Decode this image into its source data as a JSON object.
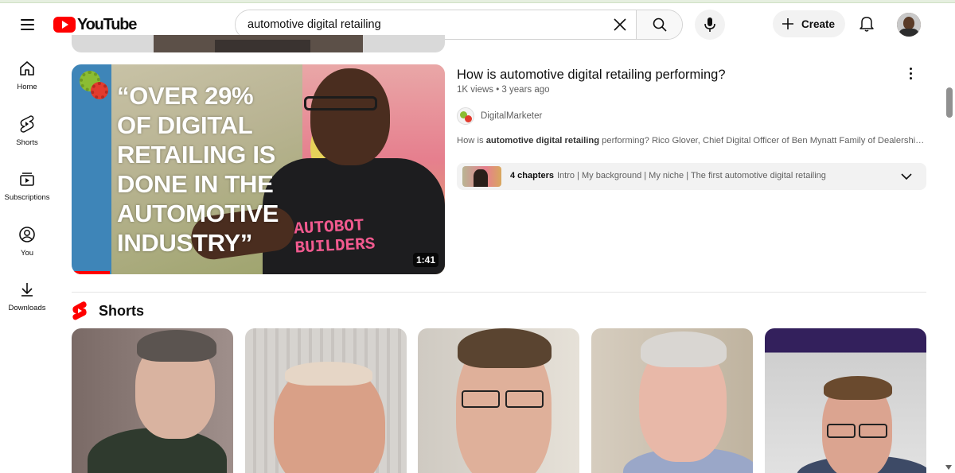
{
  "header": {
    "logo_text": "YouTube",
    "search_value": "automotive digital retailing",
    "create_label": "Create"
  },
  "sidebar": {
    "items": [
      {
        "label": "Home",
        "icon": "home-icon"
      },
      {
        "label": "Shorts",
        "icon": "shorts-icon"
      },
      {
        "label": "Subscriptions",
        "icon": "subscriptions-icon"
      },
      {
        "label": "You",
        "icon": "you-icon"
      },
      {
        "label": "Downloads",
        "icon": "download-icon"
      }
    ]
  },
  "video": {
    "thumbnail_text": "“OVER 29%\nOF DIGITAL\nRETAILING IS\nDONE IN THE\nAUTOMOTIVE\nINDUSTRY”",
    "thumbnail_shirt_text": "AUTOBOT\nBUILDERS",
    "duration": "1:41",
    "title": "How is automotive digital retailing performing?",
    "meta": "1K views • 3 years ago",
    "channel": "DigitalMarketer",
    "description_pre": "How is ",
    "description_bold": "automotive digital retailing",
    "description_post": " performing? Rico Glover, Chief Digital Officer of Ben Mynatt Family of Dealerships,...",
    "chapters_count": "4 chapters",
    "chapters_list": "Intro | My background | My niche | The first automotive digital retailing"
  },
  "shorts": {
    "title": "Shorts"
  },
  "colors": {
    "brand_red": "#ff0000",
    "text_primary": "#0f0f0f",
    "text_secondary": "#606060",
    "chip_bg": "#f2f2f2"
  }
}
